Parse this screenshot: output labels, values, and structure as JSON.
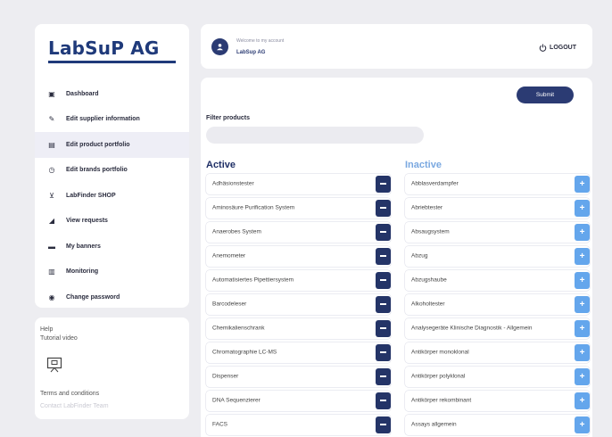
{
  "brand": {
    "name": "LabSuP AG"
  },
  "sidebar": {
    "items": [
      {
        "label": "Dashboard",
        "icon": "dashboard-icon",
        "glyph": "▣",
        "active": false
      },
      {
        "label": "Edit supplier information",
        "icon": "edit-document-icon",
        "glyph": "✎",
        "active": false
      },
      {
        "label": "Edit product portfolio",
        "icon": "portfolio-icon",
        "glyph": "▤",
        "active": true
      },
      {
        "label": "Edit brands portfolio",
        "icon": "brands-icon",
        "glyph": "◷",
        "active": false
      },
      {
        "label": "LabFinder SHOP",
        "icon": "cart-icon",
        "glyph": "⊻",
        "active": false
      },
      {
        "label": "View requests",
        "icon": "requests-icon",
        "glyph": "◢",
        "active": false
      },
      {
        "label": "My banners",
        "icon": "banner-icon",
        "glyph": "▬",
        "active": false
      },
      {
        "label": "Monitoring",
        "icon": "monitoring-icon",
        "glyph": "▥",
        "active": false
      },
      {
        "label": "Change password",
        "icon": "password-icon",
        "glyph": "◉",
        "active": false
      }
    ]
  },
  "help": {
    "help_label": "Help",
    "tutorial_label": "Tutorial video",
    "terms_label": "Terms and conditions",
    "contact_label": "Contact LabFinder Team"
  },
  "header": {
    "welcome": "Welcome to my account",
    "account_name": "LabSup AG",
    "logout_label": "LOGOUT"
  },
  "main": {
    "submit_label": "Submit",
    "filter_label": "Filter products",
    "filter_value": "",
    "active_heading": "Active",
    "inactive_heading": "Inactive",
    "active_items": [
      "Adhäsionstester",
      "Aminosäure Purification System",
      "Anaerobes System",
      "Anemometer",
      "Automatisiertes Pipettiersystem",
      "Barcodeleser",
      "Chemikalienschrank",
      "Chromatographie LC-MS",
      "Dispenser",
      "DNA Sequenzierer",
      "FACS"
    ],
    "inactive_items": [
      "Abblasverdampfer",
      "Abriebtester",
      "Absaugsystem",
      "Abzug",
      "Abzugshaube",
      "Alkoholtester",
      "Analysegeräte Klinische Diagnostik - Allgemein",
      "Antikörper monoklonal",
      "Antikörper polyklonal",
      "Antikörper rekombinant",
      "Assays allgemein"
    ]
  },
  "colors": {
    "brand": "#1f3a7a",
    "primary": "#243467",
    "inactive_accent": "#64a6ec",
    "background": "#ededf1"
  }
}
